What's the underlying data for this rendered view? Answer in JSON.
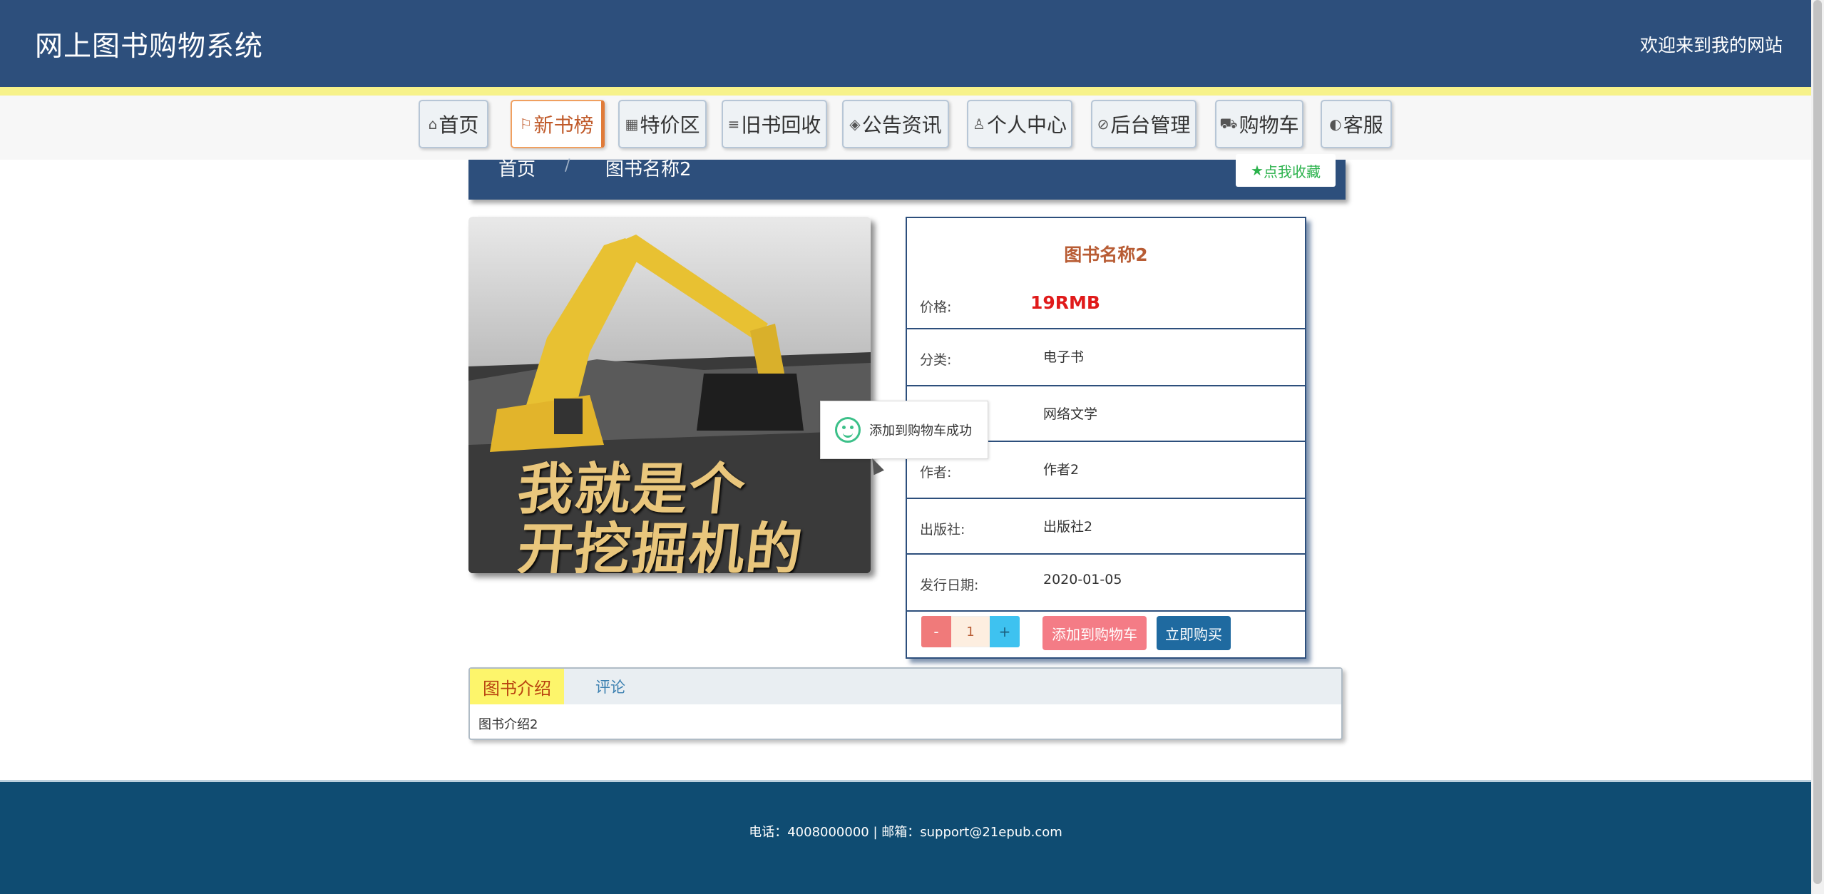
{
  "header": {
    "site_title": "网上图书购物系统",
    "welcome": "欢迎来到我的网站"
  },
  "nav": {
    "items": [
      {
        "label": "首页",
        "icon": "home-icon"
      },
      {
        "label": "新书榜",
        "icon": "flag-icon"
      },
      {
        "label": "特价区",
        "icon": "grid-icon"
      },
      {
        "label": "旧书回收",
        "icon": "sliders-icon"
      },
      {
        "label": "公告资讯",
        "icon": "layers-icon"
      },
      {
        "label": "个人中心",
        "icon": "user-icon"
      },
      {
        "label": "后台管理",
        "icon": "link-icon"
      },
      {
        "label": "购物车",
        "icon": "cart-icon"
      },
      {
        "label": "客服",
        "icon": "chat-icon"
      }
    ],
    "active": "新书榜"
  },
  "breadcrumb": {
    "home": "首页",
    "separator": "/",
    "current": "图书名称2",
    "favorite_label": "点我收藏"
  },
  "book": {
    "cover_text_line1": "我就是个",
    "cover_text_line2": "开挖掘机的",
    "title": "图书名称2",
    "price_label": "价格:",
    "price_value": "19RMB",
    "category_label": "分类:",
    "category_value": "电子书",
    "genre_value": "网络文学",
    "author_label": "作者:",
    "author_value": "作者2",
    "publisher_label": "出版社:",
    "publisher_value": "出版社2",
    "date_label": "发行日期:",
    "date_value": "2020-01-05"
  },
  "purchase": {
    "minus": "-",
    "quantity": "1",
    "plus": "+",
    "add_to_cart": "添加到购物车",
    "buy_now": "立即购买"
  },
  "toast": {
    "message": "添加到购物车成功",
    "icon": "smile-icon"
  },
  "tabs": {
    "intro_label": "图书介绍",
    "comment_label": "评论",
    "content": "图书介绍2"
  },
  "footer": {
    "text": "电话：4008000000 | 邮箱：support@21epub.com"
  },
  "colors": {
    "header_bg": "#2d4f7c",
    "footer_bg": "#0f4c72",
    "accent_yellow": "#f7f28a",
    "price_red": "#e01a1a"
  }
}
